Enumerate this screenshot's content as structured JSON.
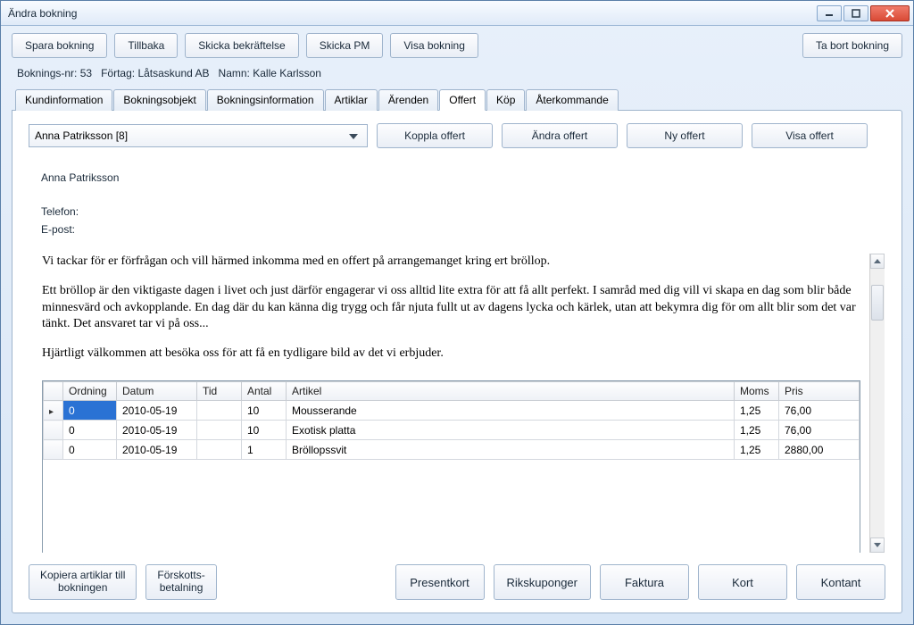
{
  "window": {
    "title": "Ändra bokning"
  },
  "toolbar": {
    "save": "Spara bokning",
    "back": "Tillbaka",
    "send_confirm": "Skicka bekräftelse",
    "send_pm": "Skicka PM",
    "show_booking": "Visa bokning",
    "delete": "Ta bort bokning"
  },
  "info": {
    "bookingnr_label": "Boknings-nr:",
    "bookingnr": "53",
    "company_label": "Förtag:",
    "company": "Låtsaskund AB",
    "name_label": "Namn:",
    "name": "Kalle Karlsson"
  },
  "tabs": {
    "kundinformation": "Kundinformation",
    "bokningsobjekt": "Bokningsobjekt",
    "bokningsinformation": "Bokningsinformation",
    "artiklar": "Artiklar",
    "arenden": "Ärenden",
    "offert": "Offert",
    "kop": "Köp",
    "aterkommande": "Återkommande"
  },
  "offert": {
    "combo_value": "Anna Patriksson  [8]",
    "koppla": "Koppla offert",
    "andra": "Ändra offert",
    "ny": "Ny offert",
    "visa": "Visa offert"
  },
  "customer": {
    "name": "Anna Patriksson",
    "phone_label": "Telefon:",
    "email_label": "E-post:"
  },
  "letter": {
    "p1": "Vi tackar för er förfrågan och vill härmed inkomma med en offert på arrangemanget kring ert bröllop.",
    "p2": "Ett bröllop är den viktigaste dagen i livet och just därför engagerar vi oss alltid lite extra för att få allt perfekt. I samråd med dig vill vi skapa en dag som blir både minnesvärd och avkopplande. En dag där du kan känna dig trygg och får njuta fullt ut av dagens lycka och kärlek, utan att bekymra dig för om allt blir som det var tänkt. Det ansvaret tar vi på oss...",
    "p3": "Hjärtligt välkommen att besöka oss för att få en tydligare bild av det vi erbjuder."
  },
  "grid": {
    "headers": {
      "ordning": "Ordning",
      "datum": "Datum",
      "tid": "Tid",
      "antal": "Antal",
      "artikel": "Artikel",
      "moms": "Moms",
      "pris": "Pris"
    },
    "rows": [
      {
        "ord": "0",
        "datum": "2010-05-19",
        "tid": "",
        "antal": "10",
        "artikel": "Mousserande",
        "moms": "1,25",
        "pris": "76,00"
      },
      {
        "ord": "0",
        "datum": "2010-05-19",
        "tid": "",
        "antal": "10",
        "artikel": "Exotisk platta",
        "moms": "1,25",
        "pris": "76,00"
      },
      {
        "ord": "0",
        "datum": "2010-05-19",
        "tid": "",
        "antal": "1",
        "artikel": "Bröllopssvit",
        "moms": "1,25",
        "pris": "2880,00"
      }
    ]
  },
  "bottom": {
    "kopiera": "Kopiera artiklar till\nbokningen",
    "forskott": "Förskotts-\nbetalning",
    "presentkort": "Presentkort",
    "rikskuponger": "Rikskuponger",
    "faktura": "Faktura",
    "kort": "Kort",
    "kontant": "Kontant"
  }
}
